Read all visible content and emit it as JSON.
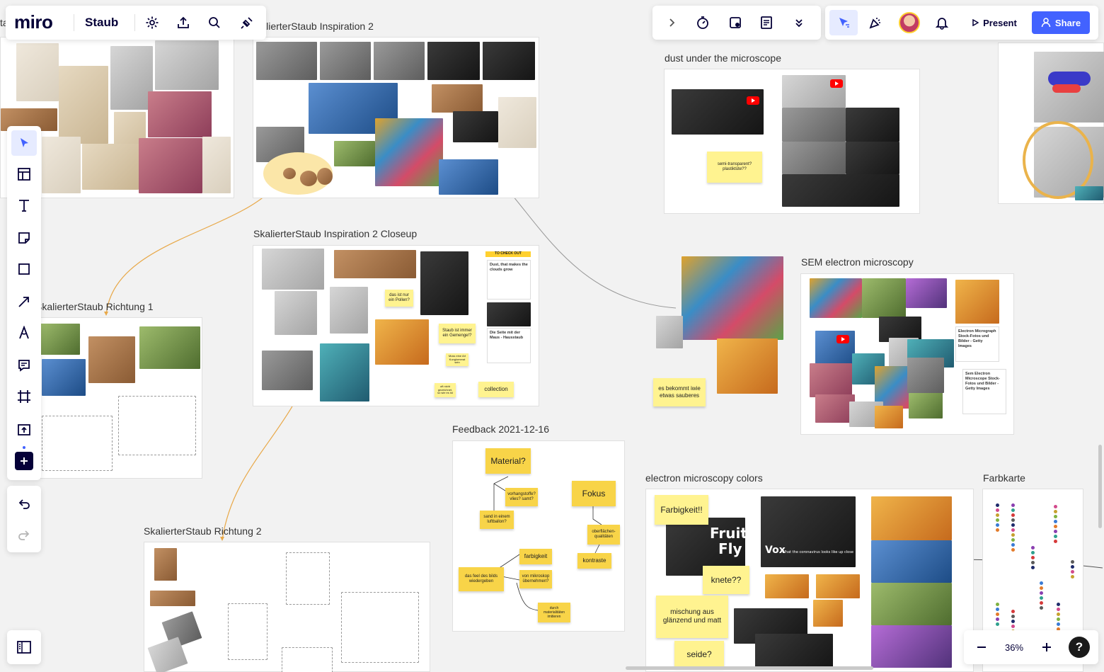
{
  "app": {
    "logo": "miro",
    "board_name": "Staub"
  },
  "frames": {
    "inspiration2": "SkalierterStaub Inspiration 2",
    "dust_microscope": "dust under the microscope",
    "closeup": "SkalierterStaub Inspiration 2 Closeup",
    "richtung1": "SkalierterStaub Richtung 1",
    "sem": "SEM electron microscopy",
    "feedback": "Feedback 2021-12-16",
    "richtung2": "SkalierterStaub Richtung 2",
    "colors": "electron microscopy colors",
    "farbkarte": "Farbkarte"
  },
  "stickies": {
    "semi_transparent": "semi-transparent? plastiktüte??",
    "pollen": "das ist nur ein Pollen?",
    "gemenge": "Staub ist immer ein Gemenge!?",
    "kunglomerat": "Muss eine Art Kunglomerat sein",
    "gezeichnet": "oft nicht gezeichnet, so wie es ist",
    "collection": "collection",
    "sauberes": "es bekommt iwie etwas sauberes",
    "material": "Material?",
    "vorhangstoffe": "vorhangstoffe? vlies? samt?",
    "luftballon": "sand in einem luftballon?",
    "fokus": "Fokus",
    "oberflaechen": "oberflächen-qualitäten",
    "farbigkeit_small": "farbigkeit",
    "feel": "das feel des bilds wiedergeben",
    "mikroskop": "von mikroskop übernehmen?",
    "kontraste": "kontraste",
    "materialitaeten": "durch materialitäten imitieren",
    "farbigkeit": "Farbigkeit!!",
    "knete": "knete??",
    "mischung": "mischung aus glänzend und matt",
    "seide": "seide?"
  },
  "closeup_doc": {
    "banner": "TO CHECK OUT",
    "card1_title": "Dust, that makes the clouds grow",
    "card2_title": "Die Seite mit der Maus - Hausstaub"
  },
  "sem_docs": {
    "doc1_title": "Electron Micrograph Stock-Fotos und Bilder - Getty Images",
    "doc2_title": "Sem Electron Microscope Stock-Fotos und Bilder - Getty Images"
  },
  "video": {
    "fruit": "Fruit",
    "fly": "Fly",
    "vox": "Vox",
    "vox_caption": "What the coronavirus looks like up close"
  },
  "toolbar_top_right": {
    "present": "Present",
    "share": "Share"
  },
  "zoom": {
    "level": "36%"
  },
  "help": "?",
  "colors": {
    "accent": "#4262ff",
    "sticky": "#fff390",
    "sticky_dark": "#f8d448",
    "connector": "#e8a848"
  },
  "farbkarte_dots": [
    "#1e2b6b",
    "#d24a8c",
    "#c6a12e",
    "#7fb241",
    "#3a7bd5",
    "#e37b2b",
    "#8a3fb1",
    "#2fa08e",
    "#d63a3a",
    "#5a5a5a"
  ]
}
